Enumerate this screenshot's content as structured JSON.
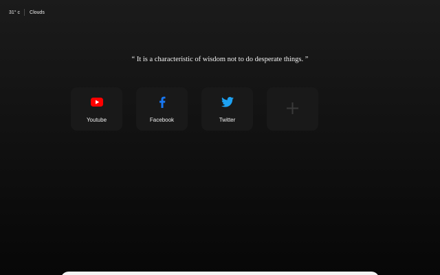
{
  "weather": {
    "temperature": "31° c",
    "condition": "Clouds"
  },
  "quote": {
    "text": "“ It is a characteristic of wisdom not to do desperate things. ”"
  },
  "shortcuts": [
    {
      "label": "Youtube",
      "icon": "youtube-icon",
      "color": "#ff0000"
    },
    {
      "label": "Facebook",
      "icon": "facebook-icon",
      "color": "#1877f2"
    },
    {
      "label": "Twitter",
      "icon": "twitter-icon",
      "color": "#1da1f2"
    }
  ],
  "add_tile": {
    "icon": "plus-icon",
    "color": "#3a3a3a"
  },
  "colors": {
    "background_top": "#1b1b1b",
    "background_bottom": "#070707",
    "tile": "#191919",
    "text": "#f2f2f2"
  }
}
